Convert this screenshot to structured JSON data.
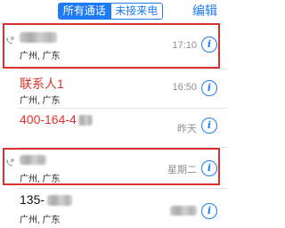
{
  "header": {
    "tabs": [
      {
        "label": "所有通话",
        "active": true
      },
      {
        "label": "未接来电",
        "active": false
      }
    ],
    "edit_label": "编辑"
  },
  "calls": [
    {
      "name": "",
      "location": "广州, 广东",
      "time": "17:10",
      "missed": false,
      "outgoing": true,
      "redacted": true
    },
    {
      "name": "联系人1",
      "location": "广州, 广东",
      "time": "16:50",
      "missed": true,
      "outgoing": false
    },
    {
      "name": "400-164-4",
      "location": "",
      "time": "昨天",
      "missed": true,
      "outgoing": false,
      "redacted_tail": true
    },
    {
      "name": "",
      "location": "广州, 广东",
      "time": "星期二",
      "missed": false,
      "outgoing": true,
      "redacted": true
    },
    {
      "name": "135-",
      "location": "广州, 广东",
      "time": "",
      "missed": false,
      "outgoing": false,
      "redacted_tail": true
    }
  ],
  "colors": {
    "accent": "#1e7bf5",
    "missed": "#e0312b",
    "highlight": "#d93030"
  },
  "icons": {
    "info": "info-circle-icon",
    "outgoing": "outgoing-phone-icon"
  }
}
